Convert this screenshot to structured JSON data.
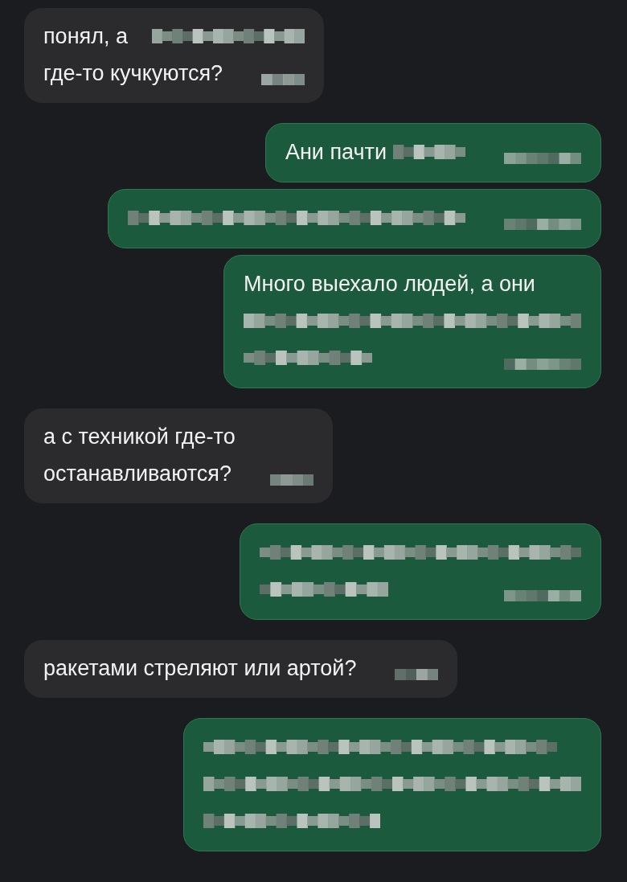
{
  "messages": [
    {
      "kind": "incoming",
      "lines": [
        [
          {
            "kind": "text",
            "text": "понял, а"
          },
          {
            "kind": "redacted"
          }
        ],
        [
          {
            "kind": "text",
            "text": "где-то кучкуются?"
          }
        ]
      ],
      "timestamp_redacted": true
    },
    {
      "kind": "outgoing",
      "lines": [
        [
          {
            "kind": "text",
            "text": "Ани пачти"
          },
          {
            "kind": "redacted"
          }
        ]
      ],
      "timestamp_redacted": true
    },
    {
      "kind": "outgoing",
      "lines": [
        [
          {
            "kind": "redacted"
          }
        ]
      ],
      "timestamp_redacted": true
    },
    {
      "kind": "outgoing",
      "lines": [
        [
          {
            "kind": "text",
            "text": "Много выехало людей, а они"
          }
        ],
        [
          {
            "kind": "redacted"
          }
        ],
        [
          {
            "kind": "redacted"
          }
        ]
      ],
      "timestamp_redacted": true
    },
    {
      "kind": "incoming",
      "lines": [
        [
          {
            "kind": "text",
            "text": "а с техникой где-то"
          }
        ],
        [
          {
            "kind": "text",
            "text": "останавливаются?"
          }
        ]
      ],
      "timestamp_redacted": true
    },
    {
      "kind": "outgoing",
      "lines": [
        [
          {
            "kind": "redacted"
          }
        ],
        [
          {
            "kind": "redacted"
          }
        ]
      ],
      "timestamp_redacted": true
    },
    {
      "kind": "incoming",
      "lines": [
        [
          {
            "kind": "text",
            "text": "ракетами стреляют или артой?"
          }
        ]
      ],
      "timestamp_redacted": true
    },
    {
      "kind": "outgoing",
      "lines": [
        [
          {
            "kind": "redacted"
          }
        ],
        [
          {
            "kind": "redacted"
          }
        ],
        [
          {
            "kind": "redacted"
          }
        ]
      ],
      "timestamp_redacted": false
    }
  ]
}
